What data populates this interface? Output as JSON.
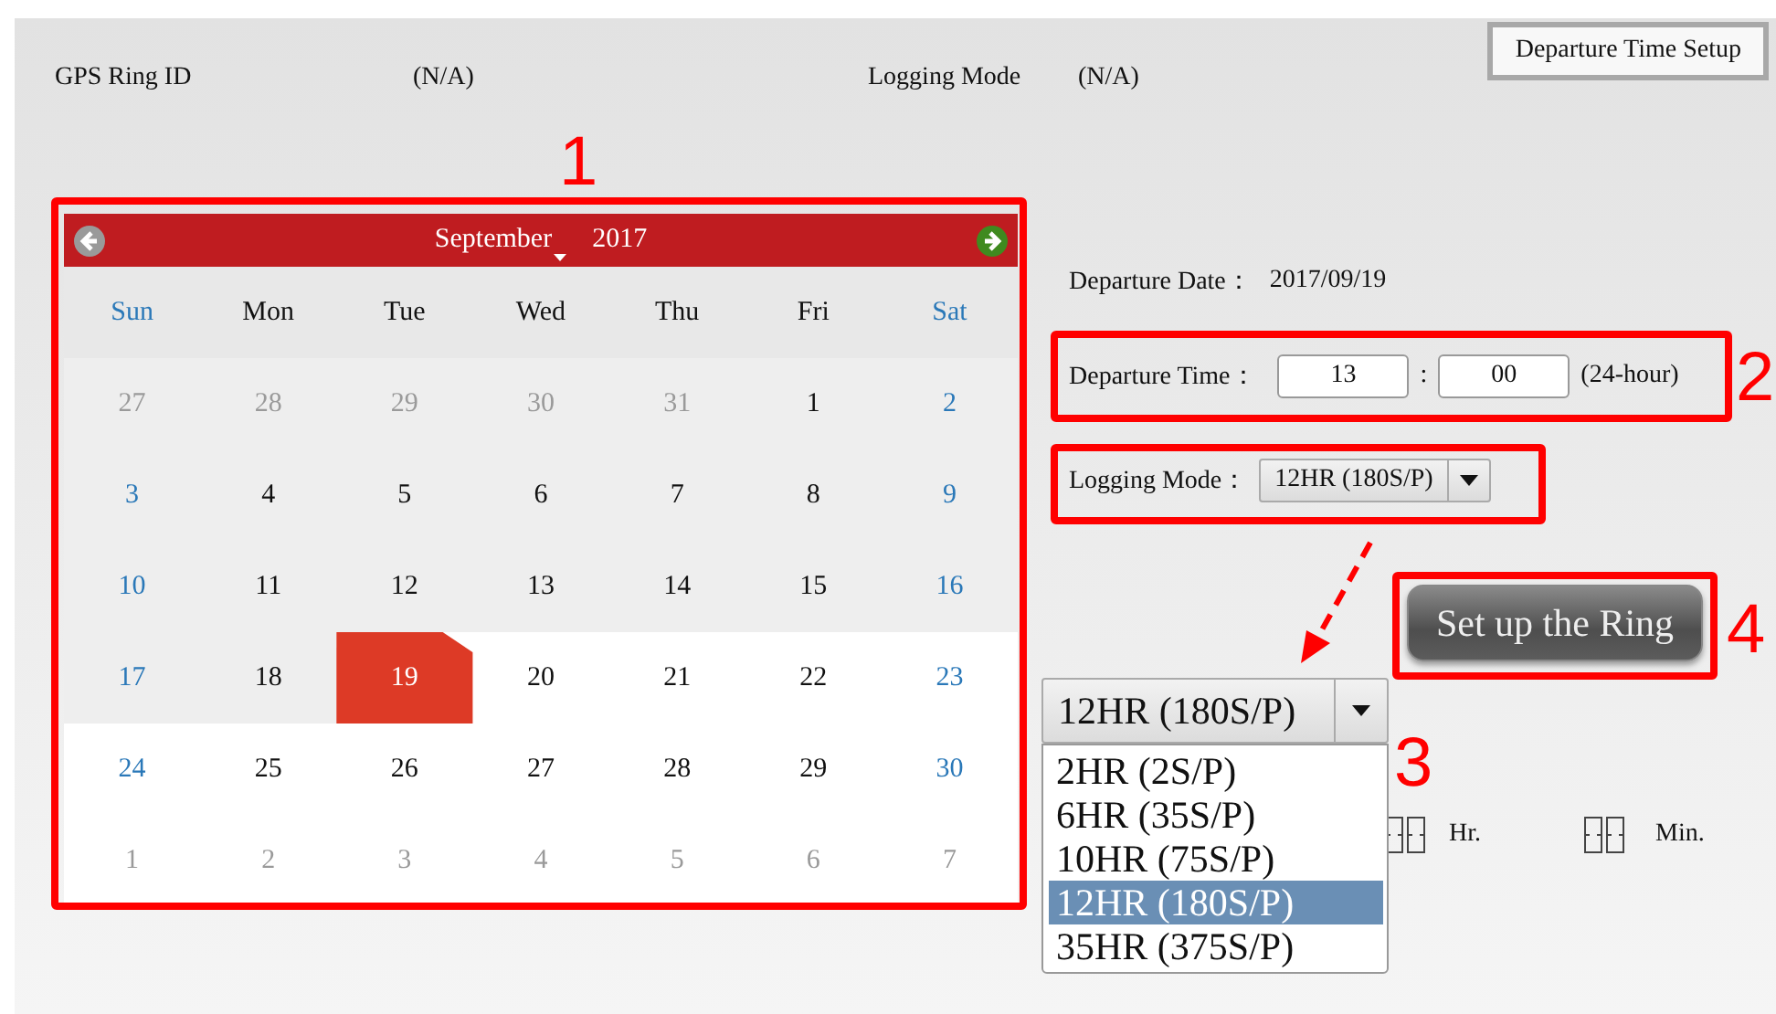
{
  "header": {
    "fields": [
      {
        "label": "GPS Ring ID",
        "value": "(N/A)"
      },
      {
        "label": "Logging Mode",
        "value": "(N/A)"
      }
    ],
    "setup_button": "Departure Time Setup"
  },
  "calendar": {
    "month": "September",
    "year": "2017",
    "weekdays": [
      {
        "label": "Sun",
        "weekend": true
      },
      {
        "label": "Mon",
        "weekend": false
      },
      {
        "label": "Tue",
        "weekend": false
      },
      {
        "label": "Wed",
        "weekend": false
      },
      {
        "label": "Thu",
        "weekend": false
      },
      {
        "label": "Fri",
        "weekend": false
      },
      {
        "label": "Sat",
        "weekend": true
      }
    ],
    "weeks": [
      [
        {
          "day": "27",
          "muted": true,
          "highlighted": true,
          "selected": false
        },
        {
          "day": "28",
          "muted": true,
          "highlighted": true,
          "selected": false
        },
        {
          "day": "29",
          "muted": true,
          "highlighted": true,
          "selected": false
        },
        {
          "day": "30",
          "muted": true,
          "highlighted": true,
          "selected": false
        },
        {
          "day": "31",
          "muted": true,
          "highlighted": true,
          "selected": false
        },
        {
          "day": "1",
          "muted": false,
          "highlighted": true,
          "selected": false
        },
        {
          "day": "2",
          "muted": false,
          "highlighted": true,
          "selected": false
        }
      ],
      [
        {
          "day": "3",
          "muted": false,
          "highlighted": true,
          "selected": false
        },
        {
          "day": "4",
          "muted": false,
          "highlighted": true,
          "selected": false
        },
        {
          "day": "5",
          "muted": false,
          "highlighted": true,
          "selected": false
        },
        {
          "day": "6",
          "muted": false,
          "highlighted": true,
          "selected": false
        },
        {
          "day": "7",
          "muted": false,
          "highlighted": true,
          "selected": false
        },
        {
          "day": "8",
          "muted": false,
          "highlighted": true,
          "selected": false
        },
        {
          "day": "9",
          "muted": false,
          "highlighted": true,
          "selected": false
        }
      ],
      [
        {
          "day": "10",
          "muted": false,
          "highlighted": true,
          "selected": false
        },
        {
          "day": "11",
          "muted": false,
          "highlighted": true,
          "selected": false
        },
        {
          "day": "12",
          "muted": false,
          "highlighted": true,
          "selected": false
        },
        {
          "day": "13",
          "muted": false,
          "highlighted": true,
          "selected": false
        },
        {
          "day": "14",
          "muted": false,
          "highlighted": true,
          "selected": false
        },
        {
          "day": "15",
          "muted": false,
          "highlighted": true,
          "selected": false
        },
        {
          "day": "16",
          "muted": false,
          "highlighted": true,
          "selected": false
        }
      ],
      [
        {
          "day": "17",
          "muted": false,
          "highlighted": true,
          "selected": false
        },
        {
          "day": "18",
          "muted": false,
          "highlighted": true,
          "selected": false
        },
        {
          "day": "19",
          "muted": false,
          "highlighted": false,
          "selected": true
        },
        {
          "day": "20",
          "muted": false,
          "highlighted": false,
          "selected": false
        },
        {
          "day": "21",
          "muted": false,
          "highlighted": false,
          "selected": false
        },
        {
          "day": "22",
          "muted": false,
          "highlighted": false,
          "selected": false
        },
        {
          "day": "23",
          "muted": false,
          "highlighted": false,
          "selected": false
        }
      ],
      [
        {
          "day": "24",
          "muted": false,
          "highlighted": false,
          "selected": false
        },
        {
          "day": "25",
          "muted": false,
          "highlighted": false,
          "selected": false
        },
        {
          "day": "26",
          "muted": false,
          "highlighted": false,
          "selected": false
        },
        {
          "day": "27",
          "muted": false,
          "highlighted": false,
          "selected": false
        },
        {
          "day": "28",
          "muted": false,
          "highlighted": false,
          "selected": false
        },
        {
          "day": "29",
          "muted": false,
          "highlighted": false,
          "selected": false
        },
        {
          "day": "30",
          "muted": false,
          "highlighted": false,
          "selected": false
        }
      ],
      [
        {
          "day": "1",
          "muted": true,
          "highlighted": false,
          "selected": false
        },
        {
          "day": "2",
          "muted": true,
          "highlighted": false,
          "selected": false
        },
        {
          "day": "3",
          "muted": true,
          "highlighted": false,
          "selected": false
        },
        {
          "day": "4",
          "muted": true,
          "highlighted": false,
          "selected": false
        },
        {
          "day": "5",
          "muted": true,
          "highlighted": false,
          "selected": false
        },
        {
          "day": "6",
          "muted": true,
          "highlighted": false,
          "selected": false
        },
        {
          "day": "7",
          "muted": true,
          "highlighted": false,
          "selected": false
        }
      ]
    ]
  },
  "form": {
    "departure_date": {
      "label": "Departure Date：",
      "value": "2017/09/19"
    },
    "departure_time": {
      "label": "Departure Time：",
      "hour": "13",
      "separator": ":",
      "minute": "00",
      "note": "(24-hour)"
    },
    "logging_mode": {
      "label": "Logging Mode：",
      "value": "12HR (180S/P)"
    },
    "setup_ring_button": "Set up the Ring",
    "duration": {
      "hour_unit": "Hr.",
      "minute_unit": "Min."
    }
  },
  "dropdown_popup": {
    "value": "12HR (180S/P)",
    "options": [
      {
        "label": "2HR (2S/P)",
        "selected": false
      },
      {
        "label": "6HR (35S/P)",
        "selected": false
      },
      {
        "label": "10HR (75S/P)",
        "selected": false
      },
      {
        "label": "12HR (180S/P)",
        "selected": true
      },
      {
        "label": "35HR (375S/P)",
        "selected": false
      }
    ]
  },
  "annotations": [
    {
      "number": "1"
    },
    {
      "number": "2"
    },
    {
      "number": "3"
    },
    {
      "number": "4"
    }
  ]
}
